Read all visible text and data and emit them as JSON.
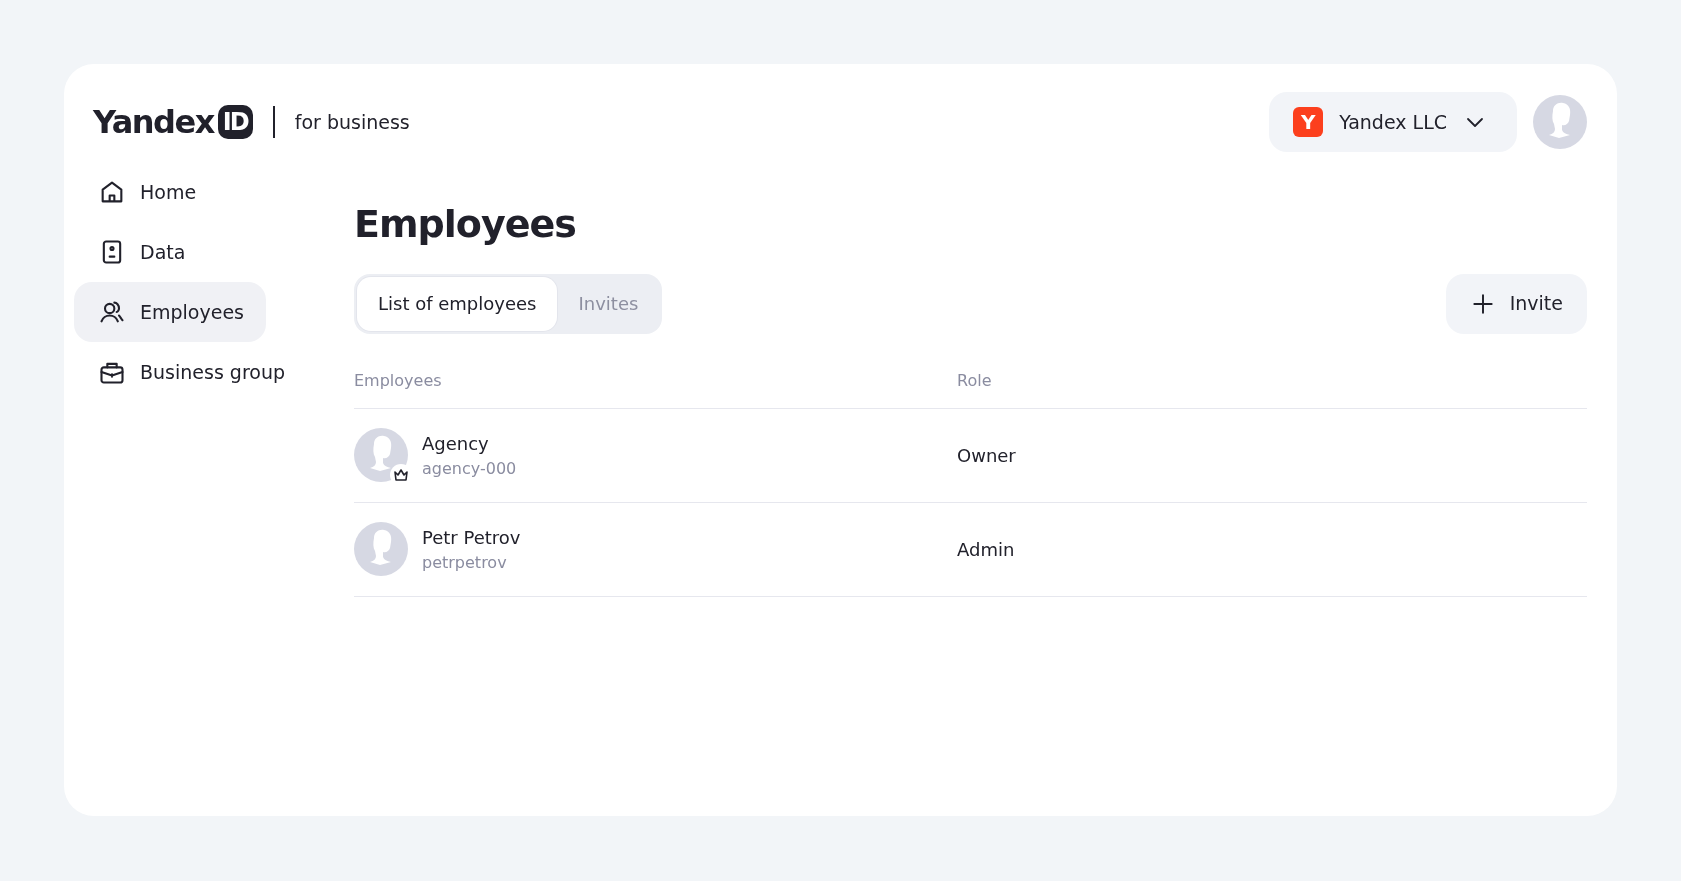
{
  "logo": {
    "wordmark": "Yandex",
    "badge": "ID",
    "suffix": "for business"
  },
  "organization": {
    "logo_letter": "Y",
    "name": "Yandex LLC"
  },
  "sidebar": {
    "items": [
      {
        "label": "Home",
        "selected": false
      },
      {
        "label": "Data",
        "selected": false
      },
      {
        "label": "Employees",
        "selected": true
      },
      {
        "label": "Business group",
        "selected": false
      }
    ]
  },
  "page_title": "Employees",
  "tabs": [
    {
      "label": "List of employees",
      "selected": true
    },
    {
      "label": "Invites",
      "selected": false
    }
  ],
  "invite_button": {
    "label": "Invite"
  },
  "table": {
    "columns": [
      "Employees",
      "Role"
    ],
    "rows": [
      {
        "name": "Agency",
        "login": "agency-000",
        "role": "Owner",
        "owner": true
      },
      {
        "name": "Petr Petrov",
        "login": "petrpetrov",
        "role": "Admin",
        "owner": false
      }
    ]
  }
}
